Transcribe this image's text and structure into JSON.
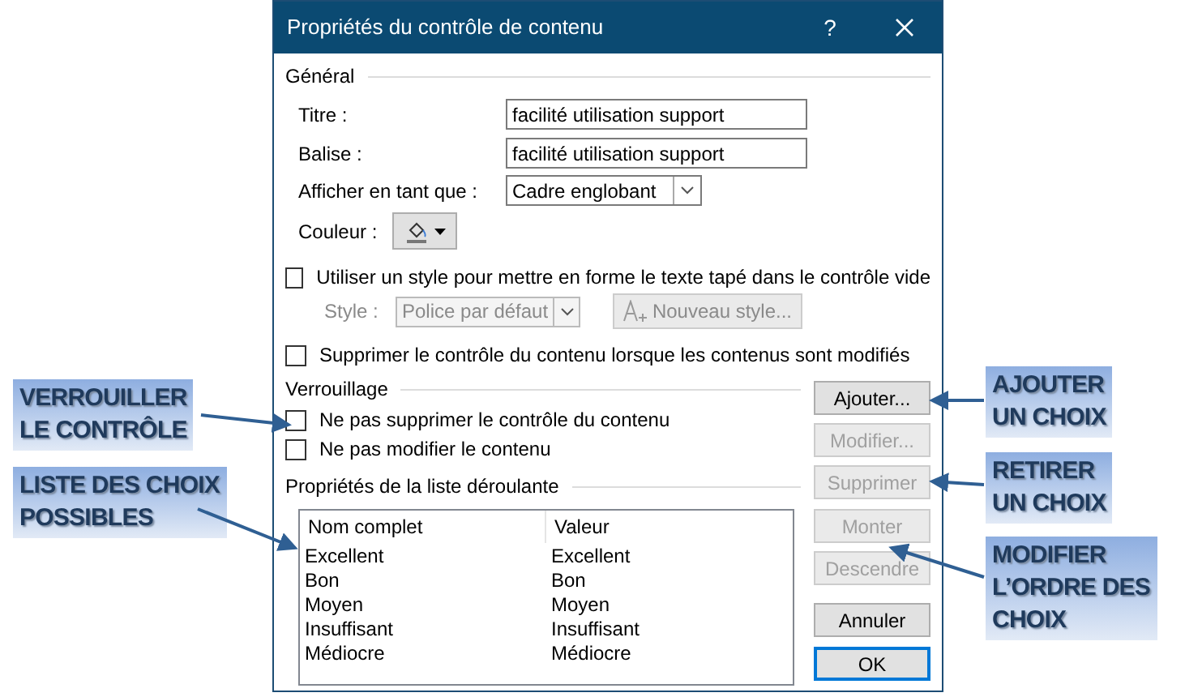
{
  "dialog": {
    "title": "Propriétés du contrôle de contenu",
    "help": "?"
  },
  "general": {
    "heading": "Général",
    "fields": [
      {
        "label": "Titre :",
        "value": "facilité utilisation support"
      },
      {
        "label": "Balise :",
        "value": "facilité utilisation support"
      }
    ],
    "display": {
      "label": "Afficher en tant que :",
      "value": "Cadre englobant"
    },
    "color": {
      "label": "Couleur :"
    },
    "use_style": {
      "label": "Utiliser un style pour mettre en forme le texte tapé dans le contrôle vide",
      "checked": false
    },
    "style": {
      "label": "Style :",
      "value": "Police par défaut",
      "disabled": true
    },
    "new_style": {
      "label": "Nouveau style...",
      "disabled": true
    },
    "remove_on_edit": {
      "label": "Supprimer le contrôle du contenu lorsque les contenus sont modifiés",
      "checked": false
    }
  },
  "locking": {
    "heading": "Verrouillage",
    "options": [
      {
        "label": "Ne pas supprimer le contrôle du contenu",
        "checked": false
      },
      {
        "label": "Ne pas modifier le contenu",
        "checked": false
      }
    ]
  },
  "dropdown_list": {
    "heading": "Propriétés de la liste déroulante",
    "columns": [
      "Nom complet",
      "Valeur"
    ],
    "rows": [
      [
        "Excellent",
        "Excellent"
      ],
      [
        "Bon",
        "Bon"
      ],
      [
        "Moyen",
        "Moyen"
      ],
      [
        "Insuffisant",
        "Insuffisant"
      ],
      [
        "Médiocre",
        "Médiocre"
      ]
    ]
  },
  "side_buttons": [
    {
      "label": "Ajouter...",
      "disabled": false
    },
    {
      "label": "Modifier...",
      "disabled": true
    },
    {
      "label": "Supprimer",
      "disabled": true
    },
    {
      "label": "Monter",
      "disabled": true
    },
    {
      "label": "Descendre",
      "disabled": true
    }
  ],
  "footer_buttons": [
    {
      "label": "Annuler",
      "default": false
    },
    {
      "label": "OK",
      "default": true
    }
  ],
  "callouts_left": [
    {
      "lines": [
        "VERROUILLER",
        "LE CONTRÔLE"
      ]
    },
    {
      "lines": [
        "LISTE DES CHOIX",
        "POSSIBLES"
      ]
    }
  ],
  "callouts_right": [
    {
      "lines": [
        "AJOUTER",
        "UN CHOIX"
      ]
    },
    {
      "lines": [
        "RETIRER",
        "UN CHOIX"
      ]
    },
    {
      "lines": [
        "MODIFIER",
        "L’ORDRE DES",
        "CHOIX"
      ]
    }
  ]
}
